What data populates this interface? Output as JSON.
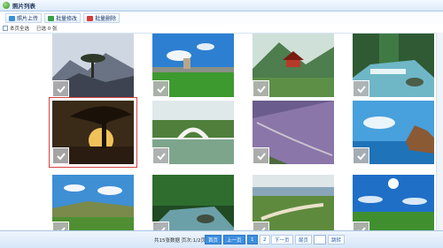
{
  "window": {
    "title": "照片列表"
  },
  "toolbar": {
    "upload": "照片上传",
    "batch_edit": "批量修改",
    "batch_delete": "批量删除"
  },
  "selection": {
    "select_page": "本页全选",
    "selected_count": "已选 0 张"
  },
  "photos": [
    {
      "scene": "mountain-pine",
      "checked": true,
      "selected": false
    },
    {
      "scene": "town-meadow",
      "checked": true,
      "selected": false
    },
    {
      "scene": "pagoda-hill",
      "checked": true,
      "selected": false
    },
    {
      "scene": "waterfall-river",
      "checked": true,
      "selected": false
    },
    {
      "scene": "sunset-tree",
      "checked": true,
      "selected": true
    },
    {
      "scene": "arch-bridge",
      "checked": true,
      "selected": false
    },
    {
      "scene": "purple-slope",
      "checked": true,
      "selected": false
    },
    {
      "scene": "sea-cliff",
      "checked": true,
      "selected": false
    },
    {
      "scene": "green-hills",
      "checked": true,
      "selected": false
    },
    {
      "scene": "forest-stream",
      "checked": true,
      "selected": false
    },
    {
      "scene": "boardwalk-lake",
      "checked": true,
      "selected": false
    },
    {
      "scene": "sunny-field",
      "checked": true,
      "selected": false
    }
  ],
  "pager": {
    "info": "共15张数据 页次:1/2页",
    "first": "首页",
    "prev": "上一页",
    "page1": "1",
    "page2": "2",
    "next": "下一页",
    "last": "尾页",
    "go": "跳转"
  }
}
